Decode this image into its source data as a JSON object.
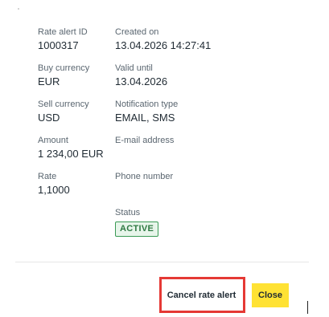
{
  "details": {
    "rate_alert_id": {
      "label": "Rate alert ID",
      "value": "1000317"
    },
    "created_on": {
      "label": "Created on",
      "value": "13.04.2026 14:27:41"
    },
    "buy_currency": {
      "label": "Buy currency",
      "value": "EUR"
    },
    "valid_until": {
      "label": "Valid until",
      "value": "13.04.2026"
    },
    "sell_currency": {
      "label": "Sell currency",
      "value": "USD"
    },
    "notification_type": {
      "label": "Notification type",
      "value": "EMAIL, SMS"
    },
    "amount": {
      "label": "Amount",
      "value": "1 234,00 EUR"
    },
    "email_address": {
      "label": "E-mail address",
      "value": ""
    },
    "rate": {
      "label": "Rate",
      "value": "1,1000"
    },
    "phone_number": {
      "label": "Phone number",
      "value": ""
    },
    "status": {
      "label": "Status",
      "value": "ACTIVE"
    }
  },
  "actions": {
    "cancel_label": "Cancel rate alert",
    "close_label": "Close"
  },
  "colors": {
    "status_active_border": "#3a9a55",
    "status_active_bg": "#e7f5ea",
    "status_active_text": "#2f7a43",
    "close_button_bg": "#ffe234",
    "highlight_outline": "#e53935"
  }
}
